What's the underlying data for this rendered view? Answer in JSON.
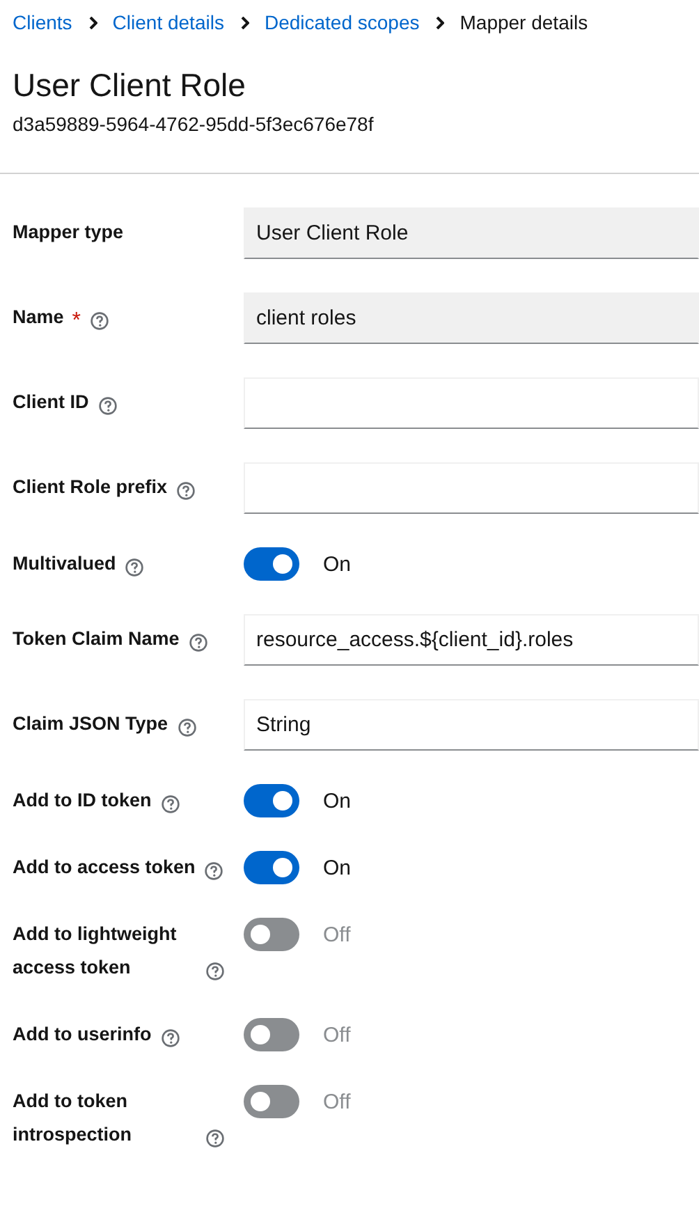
{
  "breadcrumb": [
    {
      "label": "Clients",
      "current": false
    },
    {
      "label": "Client details",
      "current": false
    },
    {
      "label": "Dedicated scopes",
      "current": false
    },
    {
      "label": "Mapper details",
      "current": true
    }
  ],
  "title": "User Client Role",
  "subtitle": "d3a59889-5964-4762-95dd-5f3ec676e78f",
  "form": [
    {
      "kind": "field",
      "label": "Mapper type",
      "help": false,
      "readonly": true,
      "value": "User Client Role"
    },
    {
      "kind": "field",
      "label": "Name",
      "required_mark": "*",
      "help": true,
      "readonly": true,
      "value": "client roles"
    },
    {
      "kind": "field",
      "label": "Client ID",
      "help": true,
      "readonly": false
    },
    {
      "kind": "field",
      "label": "Client Role prefix",
      "help": true,
      "readonly": false
    },
    {
      "kind": "switch",
      "label": "Multivalued",
      "help": true,
      "on": true,
      "state_label": "On"
    },
    {
      "kind": "field",
      "label": "Token Claim Name",
      "help": true,
      "readonly": false,
      "value": "resource_access.${client_id}.roles"
    },
    {
      "kind": "field",
      "label": "Claim JSON Type",
      "help": true,
      "readonly": false,
      "value": "String"
    },
    {
      "kind": "switch",
      "label": "Add to ID token",
      "help": true,
      "on": true,
      "state_label": "On"
    },
    {
      "kind": "switch",
      "label": "Add to access token",
      "help": true,
      "on": true,
      "state_label": "On"
    },
    {
      "kind": "switch",
      "label": "Add to lightweight access token",
      "help": true,
      "on": false,
      "state_label": "Off"
    },
    {
      "kind": "switch",
      "label": "Add to userinfo",
      "help": true,
      "on": false,
      "state_label": "Off"
    },
    {
      "kind": "switch",
      "label": "Add to token introspection",
      "help": true,
      "on": false,
      "state_label": "Off"
    }
  ]
}
